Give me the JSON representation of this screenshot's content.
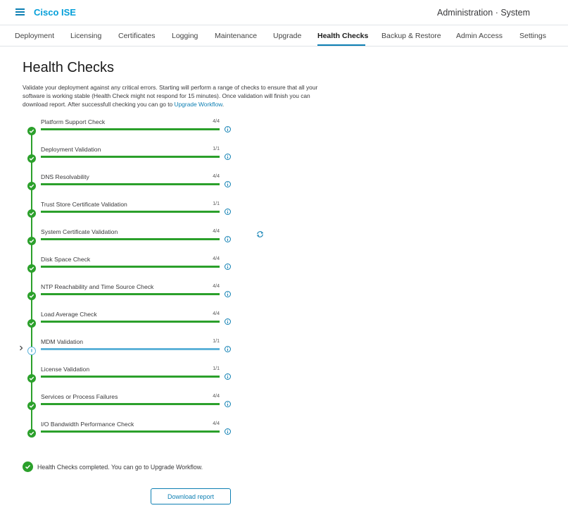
{
  "header": {
    "brand": "Cisco ISE",
    "context": "Administration · System"
  },
  "tabs": [
    {
      "label": "Deployment"
    },
    {
      "label": "Licensing"
    },
    {
      "label": "Certificates"
    },
    {
      "label": "Logging"
    },
    {
      "label": "Maintenance"
    },
    {
      "label": "Upgrade"
    },
    {
      "label": "Health Checks",
      "active": true
    },
    {
      "label": "Backup & Restore"
    },
    {
      "label": "Admin Access"
    },
    {
      "label": "Settings"
    }
  ],
  "page": {
    "title": "Health Checks",
    "description": "Validate your deployment against any critical errors. Starting will perform a range of checks to ensure that all your software is working stable (Health Check might not respond for 15 minutes). Once validation will finish you can download report. After successfull checking you can go to ",
    "description_link": "Upgrade Workflow",
    "description_end": "."
  },
  "checks": [
    {
      "name": "Platform Support Check",
      "count": "4/4",
      "progress": 1.0,
      "status": "done"
    },
    {
      "name": "Deployment Validation",
      "count": "1/1",
      "progress": 1.0,
      "status": "done"
    },
    {
      "name": "DNS Resolvability",
      "count": "4/4",
      "progress": 1.0,
      "status": "done"
    },
    {
      "name": "Trust Store Certificate Validation",
      "count": "1/1",
      "progress": 1.0,
      "status": "done"
    },
    {
      "name": "System Certificate Validation",
      "count": "4/4",
      "progress": 1.0,
      "status": "done"
    },
    {
      "name": "Disk Space Check",
      "count": "4/4",
      "progress": 1.0,
      "status": "done"
    },
    {
      "name": "NTP Reachability and Time Source Check",
      "count": "4/4",
      "progress": 1.0,
      "status": "done"
    },
    {
      "name": "Load Average Check",
      "count": "4/4",
      "progress": 1.0,
      "status": "done"
    },
    {
      "name": "MDM Validation",
      "count": "1/1",
      "progress": 1.0,
      "status": "info"
    },
    {
      "name": "License Validation",
      "count": "1/1",
      "progress": 1.0,
      "status": "done"
    },
    {
      "name": "Services or Process Failures",
      "count": "4/4",
      "progress": 1.0,
      "status": "done"
    },
    {
      "name": "I/O Bandwidth Performance Check",
      "count": "4/4",
      "progress": 1.0,
      "status": "done"
    }
  ],
  "completion": {
    "message": "Health Checks completed. You can go to Upgrade Workflow."
  },
  "actions": {
    "download_label": "Download report"
  },
  "colors": {
    "accent": "#049fd9",
    "link": "#0d7fb3",
    "success": "#2ba02b",
    "info_bar": "#5fb3d9"
  },
  "icons": {
    "menu": "hamburger-icon",
    "done": "check-circle-icon",
    "pending": "info-circle-icon",
    "details": "info-icon",
    "expand": "chevron-right-icon",
    "rerun": "refresh-icon"
  }
}
